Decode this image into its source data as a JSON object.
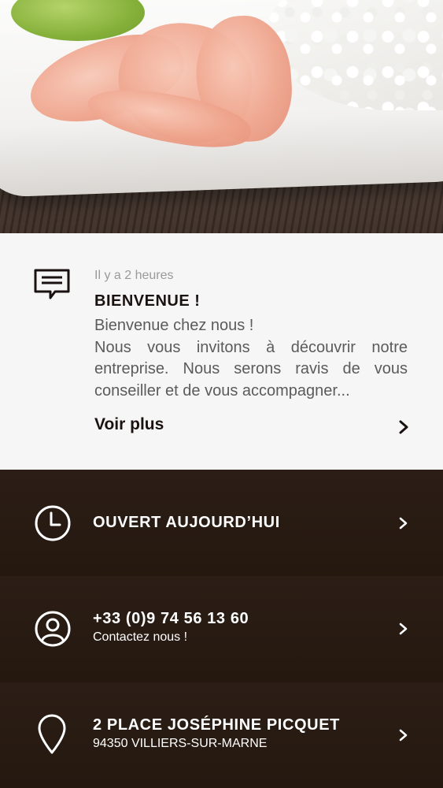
{
  "news": {
    "time": "Il y a 2 heures",
    "title": "BIENVENUE !",
    "body": "Bienvenue chez nous !\nNous vous invitons à découvrir notre entreprise. Nous serons ravis de vous conseiller et de vous accompagner...",
    "more_label": "Voir plus"
  },
  "rows": {
    "hours": {
      "title": "OUVERT AUJOURD’HUI"
    },
    "contact": {
      "title": "+33 (0)9 74 56 13 60",
      "subtitle": "Contactez nous !"
    },
    "address": {
      "title": "2 PLACE JOSÉPHINE PICQUET",
      "subtitle": "94350 VILLIERS-SUR-MARNE"
    }
  },
  "icons": {
    "message": "message-icon",
    "clock": "clock-icon",
    "contact": "user-circle-icon",
    "location": "location-pin-icon",
    "chevron": "chevron-right-icon"
  },
  "colors": {
    "dark_bg": "#2a1d15",
    "news_bg": "#f7f6f6",
    "title_dark": "#1a1210"
  }
}
